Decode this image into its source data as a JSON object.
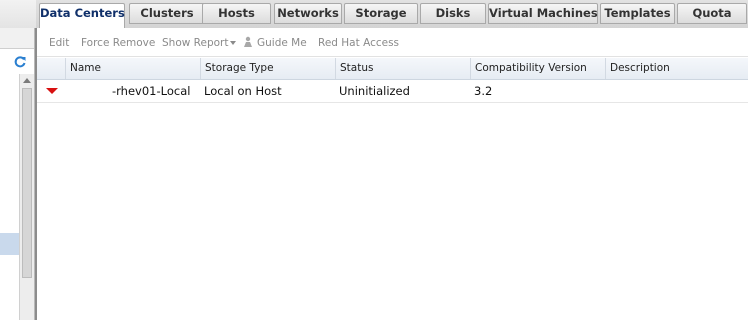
{
  "tabs": [
    {
      "label": "Data Centers",
      "active": true
    },
    {
      "label": "Clusters",
      "active": false
    },
    {
      "label": "Hosts",
      "active": false
    },
    {
      "label": "Networks",
      "active": false
    },
    {
      "label": "Storage",
      "active": false
    },
    {
      "label": "Disks",
      "active": false
    },
    {
      "label": "Virtual Machines",
      "active": false
    },
    {
      "label": "Templates",
      "active": false
    },
    {
      "label": "Quota",
      "active": false
    }
  ],
  "toolbar": {
    "edit": "Edit",
    "force_remove": "Force Remove",
    "show_report": "Show Report",
    "guide_me": "Guide Me",
    "red_hat_access": "Red Hat Access"
  },
  "grid": {
    "columns": [
      "Name",
      "Storage Type",
      "Status",
      "Compatibility Version",
      "Description"
    ],
    "rows": [
      {
        "status_icon": "down-arrow-icon",
        "name": "-rhev01-Local",
        "storage_type": "Local on Host",
        "status": "Uninitialized",
        "compatibility_version": "3.2",
        "description": ""
      }
    ]
  },
  "colors": {
    "status_down": "#d81010",
    "active_tab_text": "#10306a",
    "selection": "#c9d9ec"
  }
}
